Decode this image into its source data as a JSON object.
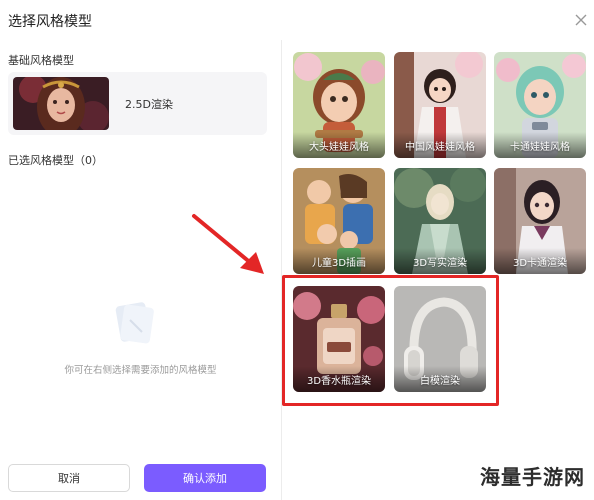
{
  "dialog": {
    "title": "选择风格模型",
    "close_icon": "close-icon"
  },
  "left_panel": {
    "base_section_label": "基础风格模型",
    "base_model": {
      "label": "2.5D渲染"
    },
    "selected_section_label": "已选风格模型（0）",
    "empty_text": "你可在右侧选择需要添加的风格模型",
    "cancel_label": "取消",
    "confirm_label": "确认添加"
  },
  "styles": [
    {
      "label": "大头娃娃风格"
    },
    {
      "label": "中国风娃娃风格"
    },
    {
      "label": "卡通娃娃风格"
    },
    {
      "label": "儿童3D插画"
    },
    {
      "label": "3D写实渲染"
    },
    {
      "label": "3D卡通渲染"
    },
    {
      "label": "3D香水瓶渲染"
    },
    {
      "label": "白模渲染"
    }
  ],
  "colors": {
    "accent": "#7b5cff",
    "highlight": "#e32626"
  },
  "watermark": "海量手游网"
}
